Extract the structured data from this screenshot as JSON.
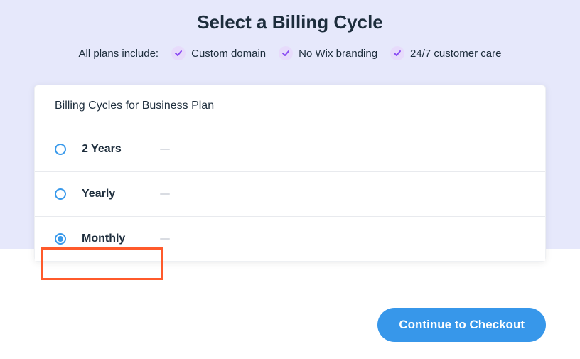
{
  "title": "Select a Billing Cycle",
  "features_label": "All plans include:",
  "features": [
    {
      "label": "Custom domain"
    },
    {
      "label": "No Wix branding"
    },
    {
      "label": "24/7 customer care"
    }
  ],
  "card": {
    "header": "Billing Cycles for Business Plan",
    "options": [
      {
        "label": "2 Years",
        "selected": false
      },
      {
        "label": "Yearly",
        "selected": false
      },
      {
        "label": "Monthly",
        "selected": true
      }
    ]
  },
  "cta": "Continue to Checkout"
}
